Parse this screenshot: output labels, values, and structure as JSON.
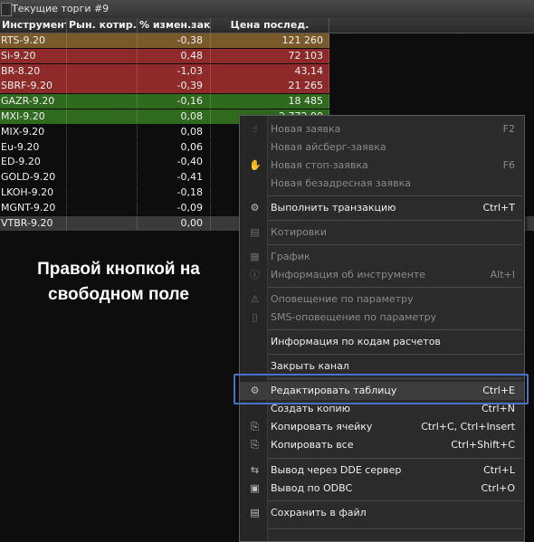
{
  "window": {
    "title": "Текущие торги #9"
  },
  "table": {
    "columns": [
      "Инструмент сокр.",
      "Рын. котир.",
      "% измен.закр.",
      "Цена послед."
    ],
    "rows": [
      {
        "name": "RTS-9.20",
        "quote": "",
        "change": "-0,38",
        "price": "121 260",
        "color": "#7a5a2a"
      },
      {
        "name": "Si-9.20",
        "quote": "",
        "change": "0,48",
        "price": "72 103",
        "color": "#8f2a2a"
      },
      {
        "name": "BR-8.20",
        "quote": "",
        "change": "-1,03",
        "price": "43,14",
        "color": "#8f2a2a"
      },
      {
        "name": "SBRF-9.20",
        "quote": "",
        "change": "-0,39",
        "price": "21 265",
        "color": "#8f2a2a"
      },
      {
        "name": "GAZR-9.20",
        "quote": "",
        "change": "-0,16",
        "price": "18 485",
        "color": "#2f6a1e"
      },
      {
        "name": "MXI-9.20",
        "quote": "",
        "change": "0,08",
        "price": "2 772,90",
        "color": "#2f6a1e"
      },
      {
        "name": "MIX-9.20",
        "quote": "",
        "change": "0,08",
        "price": "",
        "color": ""
      },
      {
        "name": "Eu-9.20",
        "quote": "",
        "change": "0,06",
        "price": "",
        "color": ""
      },
      {
        "name": "ED-9.20",
        "quote": "",
        "change": "-0,40",
        "price": "",
        "color": ""
      },
      {
        "name": "GOLD-9.20",
        "quote": "",
        "change": "-0,41",
        "price": "",
        "color": ""
      },
      {
        "name": "LKOH-9.20",
        "quote": "",
        "change": "-0,18",
        "price": "",
        "color": ""
      },
      {
        "name": "MGNT-9.20",
        "quote": "",
        "change": "-0,09",
        "price": "",
        "color": ""
      },
      {
        "name": "VTBR-9.20",
        "quote": "",
        "change": "0,00",
        "price": "",
        "color": "#3a3a3a"
      }
    ]
  },
  "caption": {
    "line1": "Правой кнопкой на",
    "line2": "свободном поле"
  },
  "menu": {
    "items": [
      {
        "label": "Новая заявка",
        "shortcut": "F2",
        "icon": "hand-icon",
        "glyph": "☝",
        "disabled": true
      },
      {
        "label": "Новая айсберг-заявка",
        "shortcut": "",
        "icon": "",
        "glyph": "",
        "disabled": true
      },
      {
        "label": "Новая стоп-заявка",
        "shortcut": "F6",
        "icon": "stop-hand-icon",
        "glyph": "✋",
        "disabled": true
      },
      {
        "label": "Новая безадресная заявка",
        "shortcut": "",
        "icon": "",
        "glyph": "",
        "disabled": true
      },
      {
        "label": "Выполнить транзакцию",
        "shortcut": "Ctrl+T",
        "icon": "transaction-icon",
        "glyph": "⚙",
        "disabled": false
      },
      {
        "label": "Котировки",
        "shortcut": "",
        "icon": "quotes-icon",
        "glyph": "▤",
        "disabled": true
      },
      {
        "label": "График",
        "shortcut": "",
        "icon": "chart-icon",
        "glyph": "▦",
        "disabled": true
      },
      {
        "label": "Информация об инструменте",
        "shortcut": "Alt+I",
        "icon": "info-icon",
        "glyph": "ⓘ",
        "disabled": true
      },
      {
        "label": "Оповещение по параметру",
        "shortcut": "",
        "icon": "alert-icon",
        "glyph": "⚠",
        "disabled": true
      },
      {
        "label": "SMS-оповещение по параметру",
        "shortcut": "",
        "icon": "sms-icon",
        "glyph": "▯",
        "disabled": true
      },
      {
        "label": "Информация по кодам расчетов",
        "shortcut": "",
        "icon": "",
        "glyph": "",
        "disabled": false
      },
      {
        "label": "Закрыть канал",
        "shortcut": "",
        "icon": "",
        "glyph": "",
        "disabled": false
      },
      {
        "label": "Редактировать таблицу",
        "shortcut": "Ctrl+E",
        "icon": "edit-table-icon",
        "glyph": "⚙",
        "disabled": false
      },
      {
        "label": "Создать копию",
        "shortcut": "Ctrl+N",
        "icon": "",
        "glyph": "",
        "disabled": false
      },
      {
        "label": "Копировать ячейку",
        "shortcut": "Ctrl+C, Ctrl+Insert",
        "icon": "copy-cell-icon",
        "glyph": "⎘",
        "disabled": false
      },
      {
        "label": "Копировать все",
        "shortcut": "Ctrl+Shift+C",
        "icon": "copy-all-icon",
        "glyph": "⎘",
        "disabled": false
      },
      {
        "label": "Вывод через DDE сервер",
        "shortcut": "Ctrl+L",
        "icon": "dde-icon",
        "glyph": "⇆",
        "disabled": false
      },
      {
        "label": "Вывод по ODBC",
        "shortcut": "Ctrl+O",
        "icon": "odbc-icon",
        "glyph": "▣",
        "disabled": false
      },
      {
        "label": "Сохранить в файл",
        "shortcut": "",
        "icon": "save-icon",
        "glyph": "▤",
        "disabled": false
      }
    ]
  }
}
